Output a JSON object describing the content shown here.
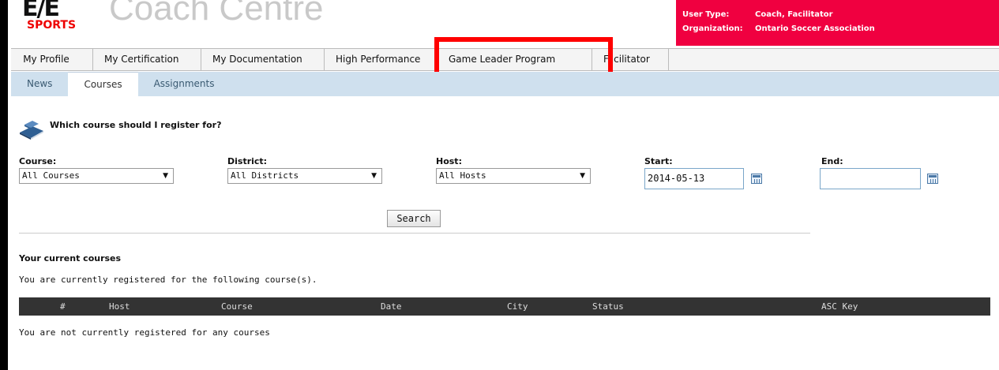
{
  "header": {
    "logo_top": "E/E",
    "logo_bottom": "SPORTS",
    "site_title": "Coach Centre",
    "user_type_label": "User Type:",
    "user_type_value": "Coach, Facilitator",
    "organization_label": "Organization:",
    "organization_value": "Ontario Soccer Association",
    "panel_color": "#f00040"
  },
  "main_nav": {
    "tabs": [
      {
        "label": "My Profile"
      },
      {
        "label": "My Certification"
      },
      {
        "label": "My Documentation"
      },
      {
        "label": "High Performance"
      },
      {
        "label": "Game Leader Program"
      },
      {
        "label": "Facilitator"
      }
    ],
    "highlighted_tab": "Game Leader Program",
    "highlight_color": "#ff0000"
  },
  "sub_nav": {
    "tabs": [
      {
        "label": "News"
      },
      {
        "label": "Courses",
        "active": true
      },
      {
        "label": "Assignments"
      }
    ]
  },
  "courses": {
    "help_link": "Which course should I register for?",
    "filters": {
      "course_label": "Course:",
      "course_value": "All Courses",
      "district_label": "District:",
      "district_value": "All Districts",
      "host_label": "Host:",
      "host_value": "All Hosts",
      "start_label": "Start:",
      "start_value": "2014-05-13",
      "end_label": "End:",
      "end_value": ""
    },
    "search_label": "Search",
    "current_title": "Your current courses",
    "current_text": "You are currently registered for the following course(s).",
    "table_headers": [
      "#",
      "Host",
      "Course",
      "Date",
      "City",
      "Status",
      "ASC Key"
    ],
    "empty_text": "You are not currently registered for any courses"
  }
}
